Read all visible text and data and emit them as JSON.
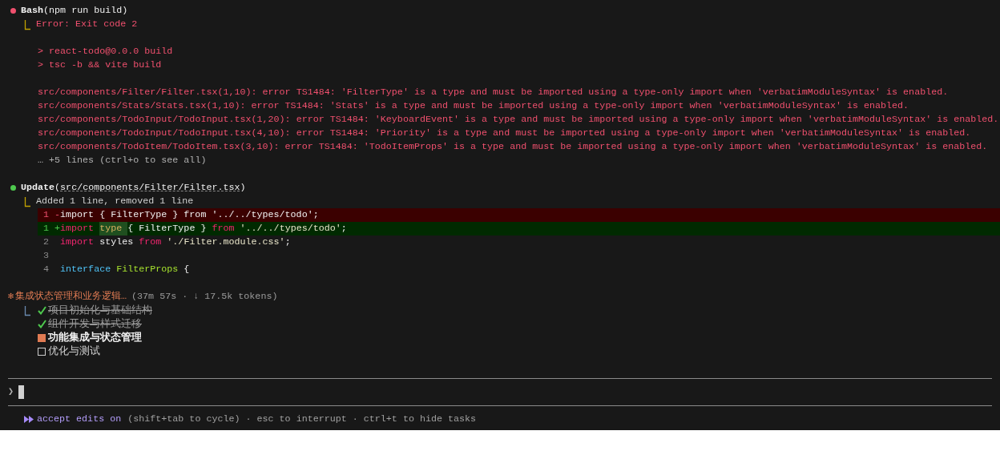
{
  "bash": {
    "kind": "error",
    "tool": "Bash",
    "argument": "(npm run build)",
    "result": "Error: Exit code 2",
    "output": [
      "> react-todo@0.0.0 build",
      "> tsc -b && vite build"
    ],
    "errors": [
      "src/components/Filter/Filter.tsx(1,10): error TS1484: 'FilterType' is a type and must be imported using a type-only import when 'verbatimModuleSyntax' is enabled.",
      "src/components/Stats/Stats.tsx(1,10): error TS1484: 'Stats' is a type and must be imported using a type-only import when 'verbatimModuleSyntax' is enabled.",
      "src/components/TodoInput/TodoInput.tsx(1,20): error TS1484: 'KeyboardEvent' is a type and must be imported using a type-only import when 'verbatimModuleSyntax' is enabled.",
      "src/components/TodoInput/TodoInput.tsx(4,10): error TS1484: 'Priority' is a type and must be imported using a type-only import when 'verbatimModuleSyntax' is enabled.",
      "src/components/TodoItem/TodoItem.tsx(3,10): error TS1484: 'TodoItemProps' is a type and must be imported using a type-only import when 'verbatimModuleSyntax' is enabled."
    ],
    "more": "… +5 lines (ctrl+o to see all)"
  },
  "update": {
    "kind": "success",
    "tool": "Update",
    "open": "(",
    "path": "src/components/Filter/Filter.tsx",
    "close": ")",
    "summary": "Added 1 line, removed 1 line",
    "diff": [
      {
        "kind": "removed",
        "number": "1",
        "sign": "-",
        "tokens": [
          {
            "kind": "plain",
            "text": "import { FilterType } from '../../types/todo';"
          }
        ]
      },
      {
        "kind": "added",
        "number": "1",
        "sign": "+",
        "tokens": [
          {
            "kind": "keyword",
            "text": "import "
          },
          {
            "kind": "changed",
            "text": "type "
          },
          {
            "kind": "plain",
            "text": "{ FilterType } "
          },
          {
            "kind": "keyword",
            "text": "from "
          },
          {
            "kind": "string",
            "text": "'../../types/todo'"
          },
          {
            "kind": "plain",
            "text": ";"
          }
        ]
      },
      {
        "kind": "context",
        "number": "2",
        "tokens": [
          {
            "kind": "keyword",
            "text": "import "
          },
          {
            "kind": "plain",
            "text": "styles "
          },
          {
            "kind": "keyword",
            "text": "from "
          },
          {
            "kind": "string",
            "text": "'./Filter.module.css'"
          },
          {
            "kind": "plain",
            "text": ";"
          }
        ]
      },
      {
        "kind": "context",
        "number": "3"
      },
      {
        "kind": "context",
        "number": "4",
        "tokens": [
          {
            "kind": "declaration",
            "text": "interface "
          },
          {
            "kind": "type",
            "text": "FilterProps "
          },
          {
            "kind": "plain",
            "text": "{"
          }
        ]
      }
    ]
  },
  "task": {
    "spinner": "✻",
    "title": "集成状态管理和业务逻辑…",
    "meta": "(37m 57s · ↓ 17.5k tokens)",
    "todos": [
      {
        "text": "项目初始化与基础结构",
        "kind": "done"
      },
      {
        "text": "组件开发与样式迁移",
        "kind": "done"
      },
      {
        "text": "功能集成与状态管理",
        "kind": "in_progress"
      },
      {
        "text": "优化与测试",
        "kind": "pending"
      }
    ]
  },
  "prompt": {
    "symbol": "❯"
  },
  "footer": {
    "mode": "accept edits on",
    "on": true,
    "hint": "(shift+tab to cycle) · esc to interrupt · ctrl+t to hide tasks"
  }
}
